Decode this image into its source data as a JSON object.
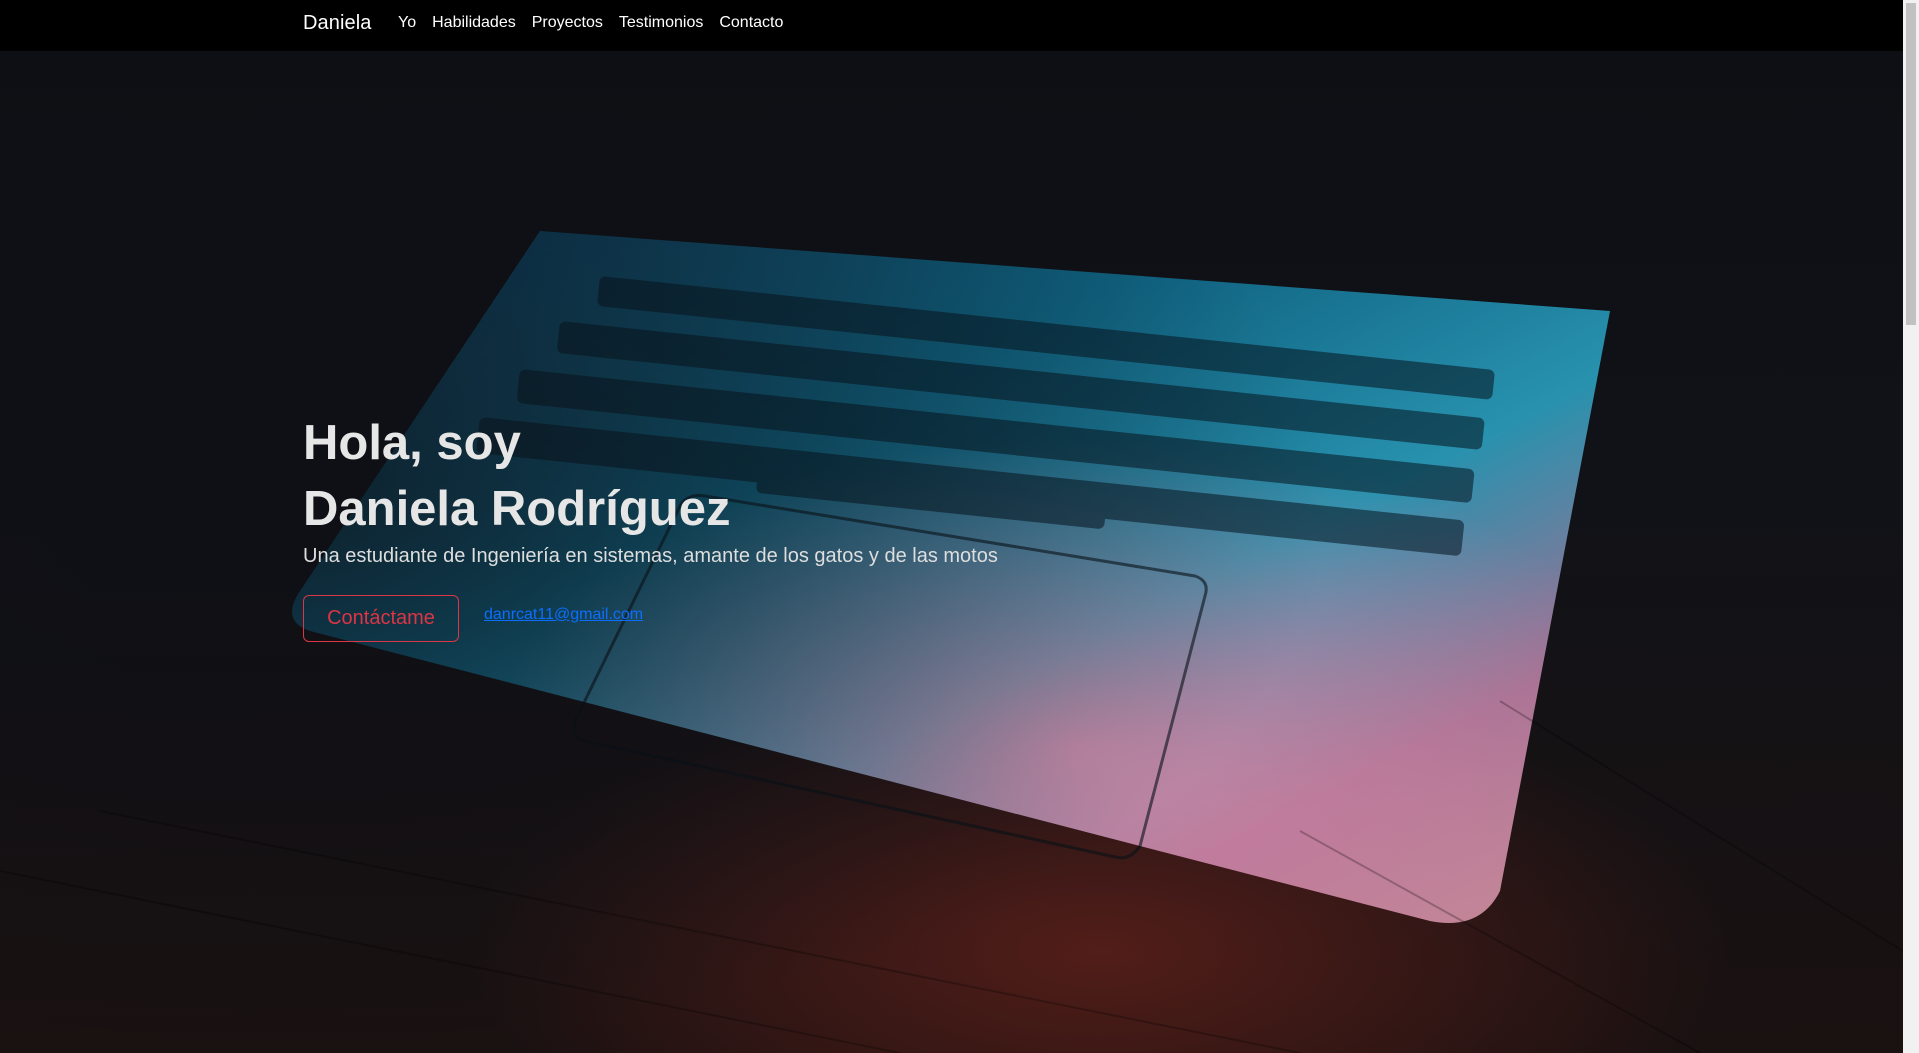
{
  "navbar": {
    "brand": "Daniela",
    "links": [
      {
        "label": "Yo"
      },
      {
        "label": "Habilidades"
      },
      {
        "label": "Proyectos"
      },
      {
        "label": "Testimonios"
      },
      {
        "label": "Contacto"
      }
    ]
  },
  "hero": {
    "title_line1": "Hola, soy",
    "title_line2": "Daniela Rodríguez",
    "subtitle": "Una estudiante de Ingeniería en sistemas, amante de los gatos y de las motos",
    "contact_button_label": "Contáctame",
    "email": "danrcat11@gmail.com",
    "background_image": "laptop-keyboard-photo"
  },
  "colors": {
    "navbar_bg": "#000000",
    "accent_danger": "#dc3545",
    "link": "#0d6efd",
    "title_text": "#e6e6e6"
  }
}
